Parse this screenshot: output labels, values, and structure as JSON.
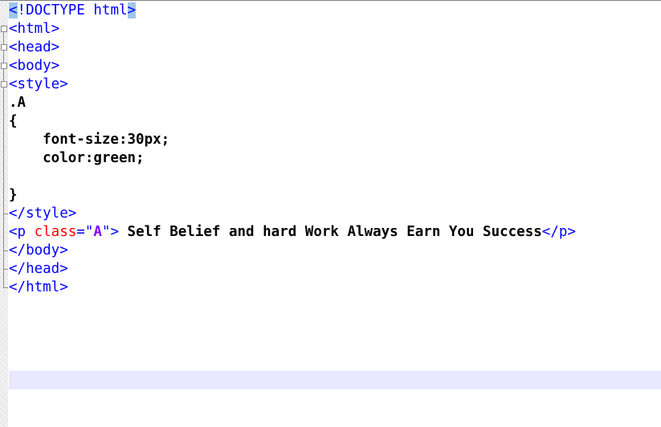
{
  "code": {
    "line1": {
      "lt": "<",
      "rest": "!DOCTYPE html",
      "gt": ">"
    },
    "line2": "<html>",
    "line3": "<head>",
    "line4": "<body>",
    "line5": "<style>",
    "line6": ".A",
    "line7": "{",
    "line8": "    font-size:30px;",
    "line9": "    color:green;",
    "line10": "",
    "line11": "}",
    "line12": "</style>",
    "line13": {
      "open": "<p ",
      "attr": "class",
      "eq": "=\"",
      "val": "A",
      "close_q": "\">",
      "text": " Self Belief and hard Work Always Earn You Success",
      "end_tag": "</p>"
    },
    "line14": "</body>",
    "line15": "</head>",
    "line16": "</html>"
  }
}
